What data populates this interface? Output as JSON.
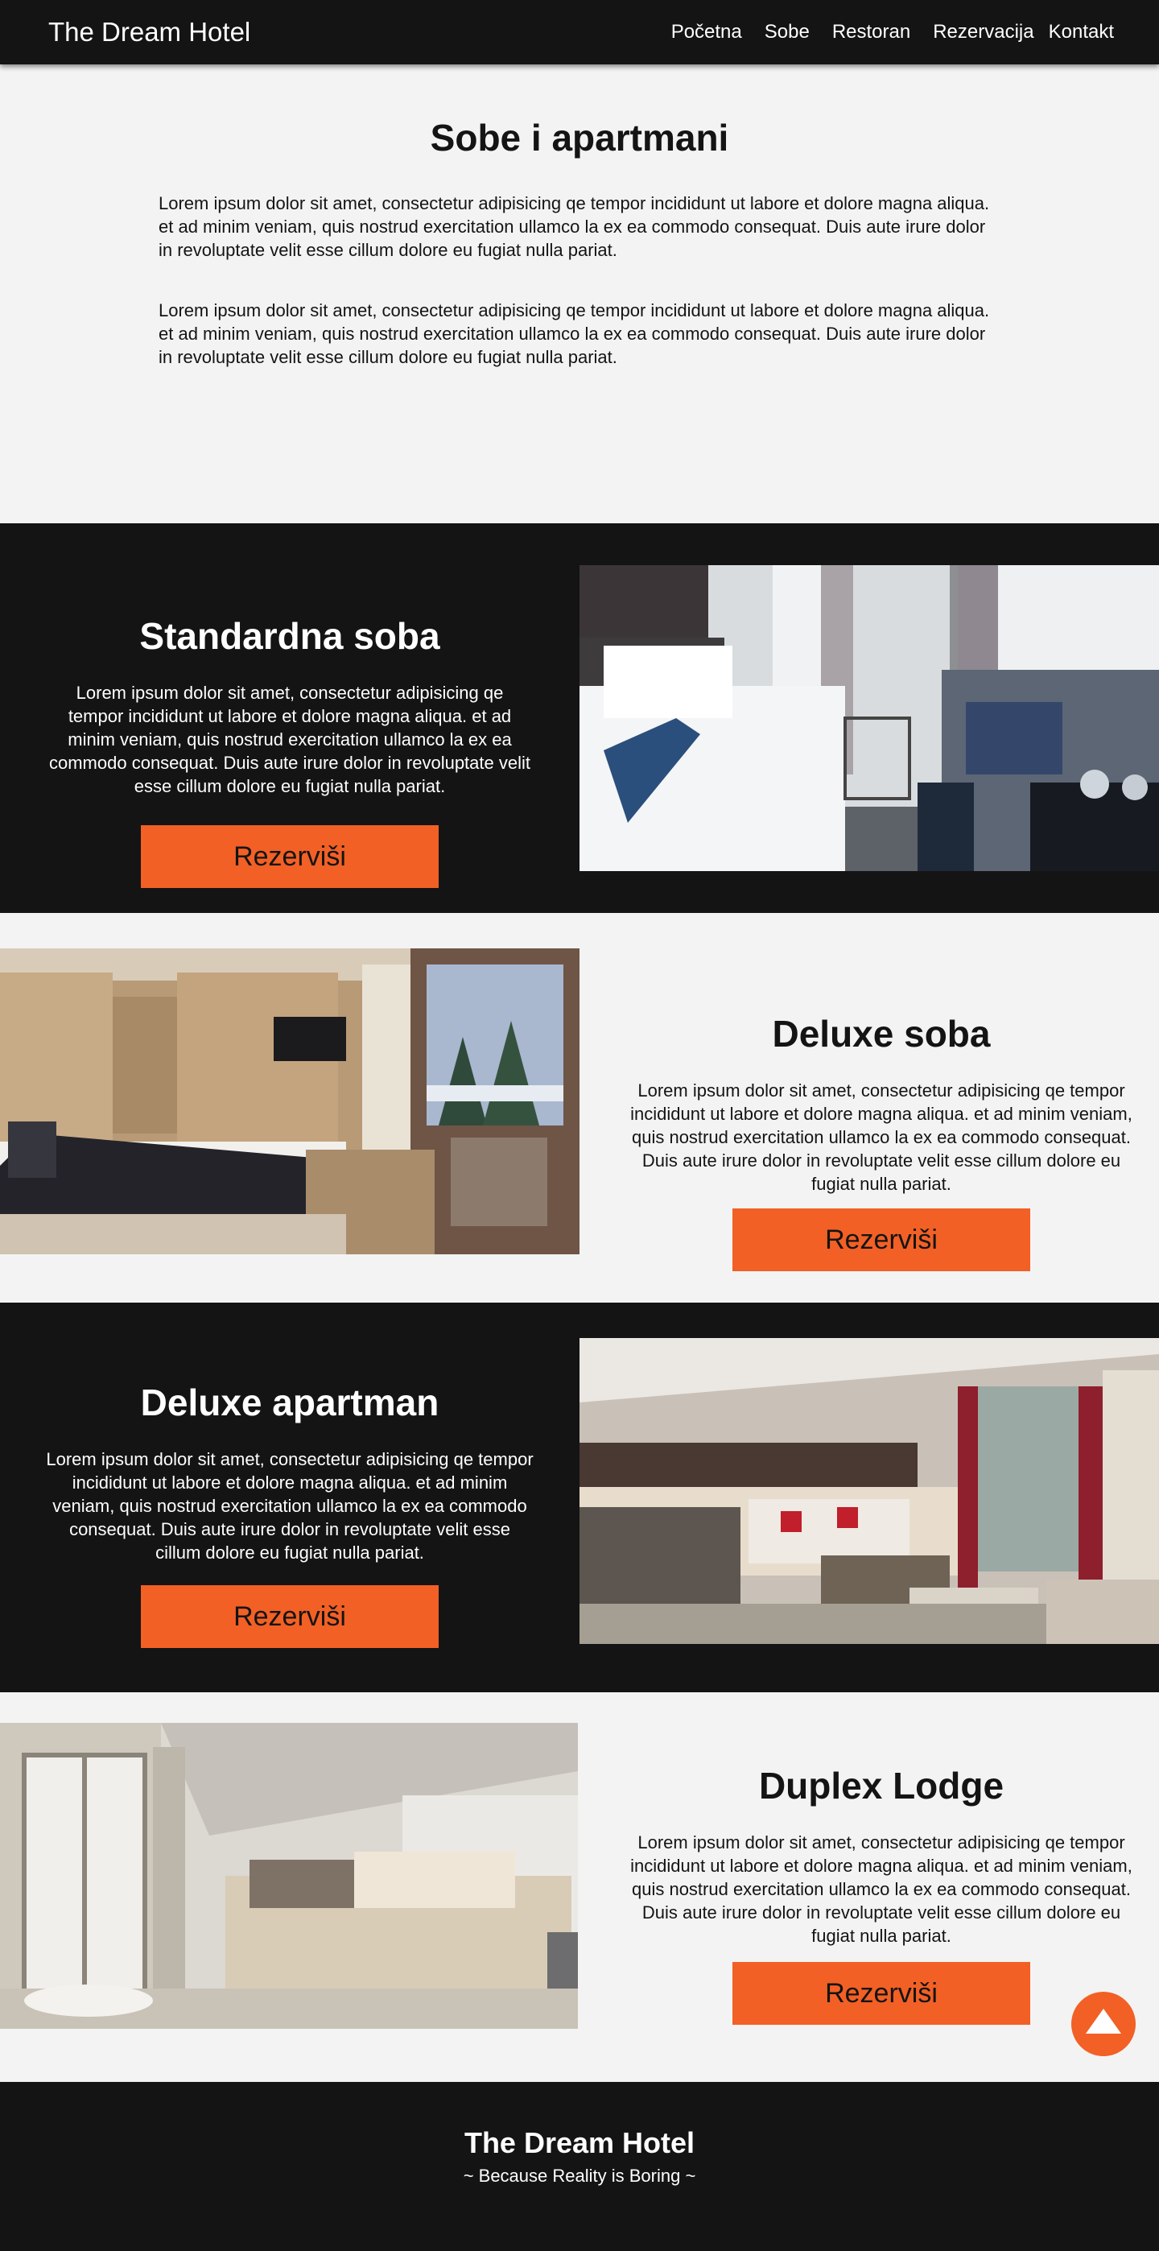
{
  "nav": {
    "brand": "The Dream Hotel",
    "links": [
      "Početna",
      "Sobe",
      "Restoran",
      "Rezervacija",
      "Kontakt"
    ]
  },
  "intro": {
    "title": "Sobe i apartmani",
    "paragraphs": [
      "Lorem ipsum dolor sit amet, consectetur adipisicing qe tempor incididunt ut labore et dolore magna aliqua. et ad minim veniam, quis nostrud exercitation ullamco la  ex ea commodo consequat. Duis aute irure dolor in revoluptate velit esse cillum dolore eu fugiat nulla pariat.",
      "Lorem ipsum dolor sit amet, consectetur adipisicing qe tempor incididunt ut labore et dolore magna aliqua. et ad minim veniam, quis nostrud exercitation ullamco la  ex ea commodo consequat. Duis aute irure dolor in revoluptate velit esse cillum dolore eu fugiat nulla pariat."
    ]
  },
  "rooms": [
    {
      "title": "Standardna soba",
      "description": "Lorem ipsum dolor sit amet, consectetur adipisicing qe tempor incididunt ut labore et dolore magna aliqua. et ad minim veniam, quis nostrud exercitation ullamco la  ex ea commodo consequat. Duis aute irure dolor in revoluptate velit esse cillum dolore eu fugiat nulla pariat.",
      "button": "Rezerviši"
    },
    {
      "title": "Deluxe soba",
      "description": "Lorem ipsum dolor sit amet, consectetur adipisicing qe tempor incididunt ut labore et dolore magna aliqua. et ad minim veniam, quis nostrud exercitation ullamco la  ex ea commodo consequat. Duis aute irure dolor in revoluptate velit esse cillum dolore eu fugiat nulla pariat.",
      "button": "Rezerviši"
    },
    {
      "title": "Deluxe apartman",
      "description": "Lorem ipsum dolor sit amet, consectetur adipisicing qe tempor incididunt ut labore et dolore magna aliqua. et ad minim veniam, quis nostrud exercitation ullamco la  ex ea commodo consequat. Duis aute irure dolor in revoluptate velit esse cillum dolore eu fugiat nulla pariat.",
      "button": "Rezerviši"
    },
    {
      "title": "Duplex Lodge",
      "description": "Lorem ipsum dolor sit amet, consectetur adipisicing qe tempor incididunt ut labore et dolore magna aliqua. et ad minim veniam, quis nostrud exercitation ullamco la  ex ea commodo consequat. Duis aute irure dolor in revoluptate velit esse cillum dolore eu fugiat nulla pariat.",
      "button": "Rezerviši"
    }
  ],
  "footer": {
    "title": "The Dream Hotel",
    "tagline": "~ Because Reality is Boring ~"
  },
  "scroll_top": {
    "icon": "arrow-up-triangle-icon"
  },
  "colors": {
    "accent": "#f26025",
    "dark": "#141414",
    "light": "#f3f3f3"
  }
}
